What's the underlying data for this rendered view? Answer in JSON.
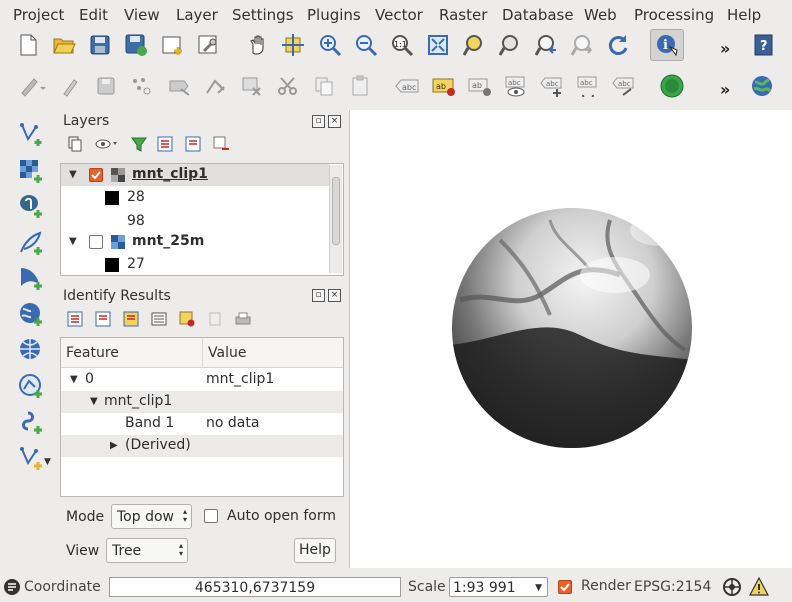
{
  "menubar": {
    "items": [
      "Project",
      "Edit",
      "View",
      "Layer",
      "Settings",
      "Plugins",
      "Vector",
      "Raster",
      "Database",
      "Web",
      "Processing",
      "Help"
    ]
  },
  "toolbar": {
    "overflow": "»"
  },
  "layers_panel": {
    "title": "Layers",
    "tree": [
      {
        "name": "mnt_clip1",
        "checked": true,
        "expanded": true,
        "legend": [
          "28",
          "98"
        ]
      },
      {
        "name": "mnt_25m",
        "checked": false,
        "expanded": true,
        "legend": [
          "27"
        ]
      }
    ]
  },
  "identify_panel": {
    "title": "Identify Results",
    "columns": [
      "Feature",
      "Value"
    ],
    "rows": [
      {
        "feature": "0",
        "value": "mnt_clip1"
      },
      {
        "feature": "mnt_clip1",
        "value": ""
      },
      {
        "feature": "Band 1",
        "value": "no data"
      },
      {
        "feature": "(Derived)",
        "value": ""
      }
    ],
    "mode_label": "Mode",
    "mode_value": "Top dow",
    "auto_open_label": "Auto open form",
    "view_label": "View",
    "view_value": "Tree",
    "help_label": "Help"
  },
  "statusbar": {
    "coordinate_label": "Coordinate",
    "coordinate_value": "465310,6737159",
    "scale_label": "Scale",
    "scale_value": "1:93 991",
    "render_label": "Render",
    "render_checked": true,
    "crs_value": "EPSG:2154"
  },
  "colors": {
    "accent": "#e8602a",
    "panel_bg": "#edeceb"
  }
}
